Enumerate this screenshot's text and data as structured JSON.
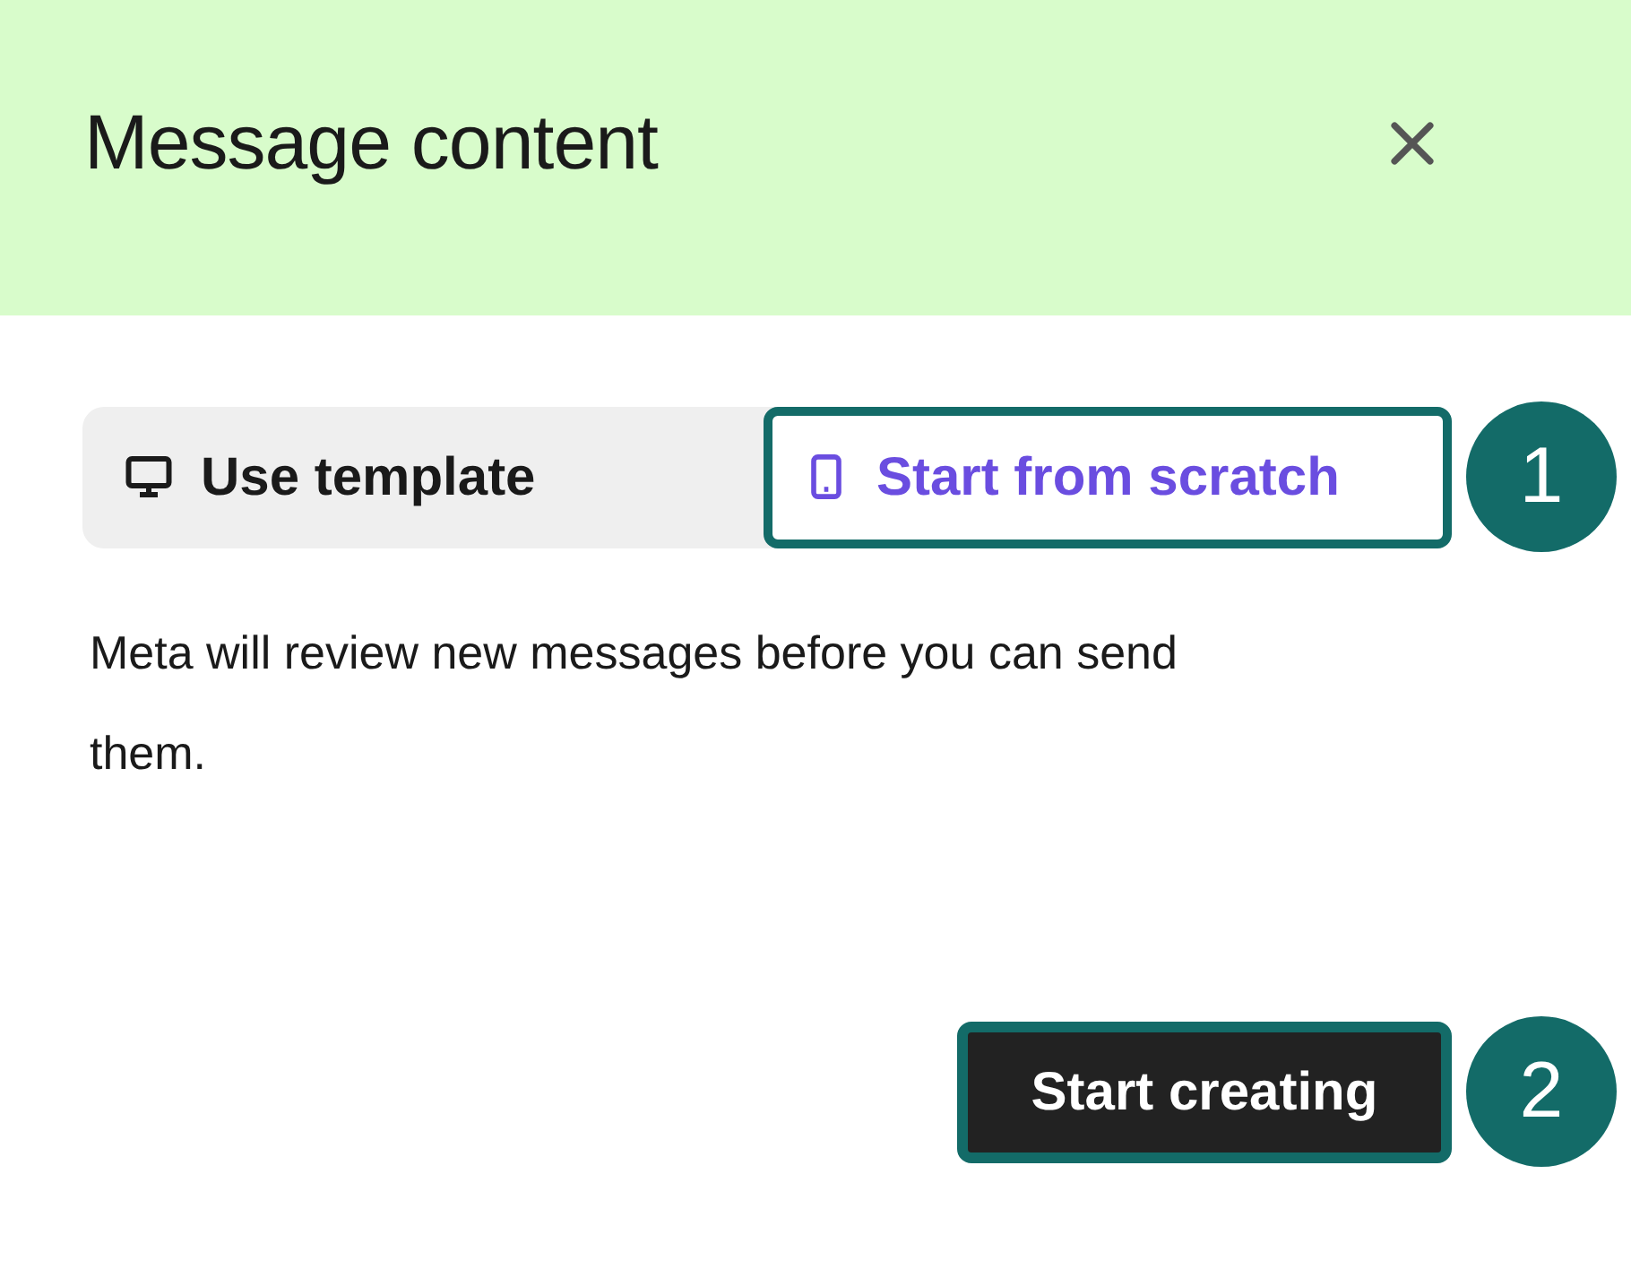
{
  "dialog": {
    "title": "Message content"
  },
  "tabs": [
    {
      "label": "Use template",
      "selected": false
    },
    {
      "label": "Start from scratch",
      "selected": true
    }
  ],
  "notice": "Meta will review new messages before you can send them.",
  "primary_button": {
    "label": "Start creating"
  },
  "callouts": [
    {
      "number": "1"
    },
    {
      "number": "2"
    }
  ]
}
